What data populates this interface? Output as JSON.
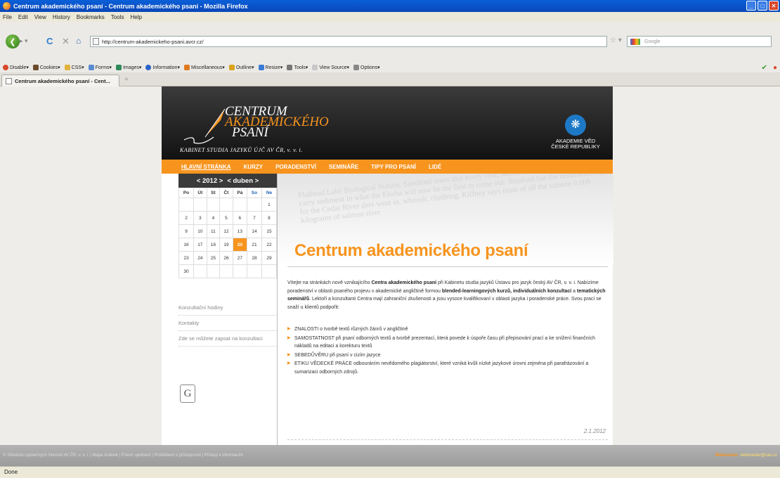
{
  "window": {
    "title": "Centrum akademického psaní - Centrum akademického psaní - Mozilla Firefox"
  },
  "menu": [
    "File",
    "Edit",
    "View",
    "History",
    "Bookmarks",
    "Tools",
    "Help"
  ],
  "nav": {
    "url": "http://centrum-akademickeho-psani.avcr.cz/",
    "search_placeholder": "Google"
  },
  "devtoolbar": [
    "Disable▾",
    "Cookies▾",
    "CSS▾",
    "Forms▾",
    "Images▾",
    "Information▾",
    "Miscellaneous▾",
    "Outline▾",
    "Resize▾",
    "Tools▾",
    "View Source▾",
    "Options▾"
  ],
  "tab": {
    "label": "Centrum akademického psaní - Cent...",
    "new": "+"
  },
  "site": {
    "logo": {
      "line1": "CENTRUM",
      "line2": "AKADEMICKÉHO",
      "line3": "PSANÍ",
      "subtitle": "KABINET STUDIA JAZYKŮ ÚJČ AV ČR, v. v. i."
    },
    "avcr": {
      "line1": "AKADEMIE VĚD",
      "line2": "ČESKÉ REPUBLIKY"
    },
    "menu": [
      "HLAVNÍ STRÁNKA",
      "KURZY",
      "PORADENSTVÍ",
      "SEMINÁŘE",
      "TIPY PRO PSANÍ",
      "LIDÉ"
    ],
    "calendar": {
      "year_nav": "< 2012 >",
      "month_nav": "< duben >",
      "weekdays": [
        "Po",
        "Út",
        "St",
        "Čt",
        "Pá",
        "So",
        "Ne"
      ],
      "weeks": [
        [
          "",
          "",
          "",
          "",
          "",
          "",
          "1"
        ],
        [
          "2",
          "3",
          "4",
          "5",
          "6",
          "7",
          "8"
        ],
        [
          "9",
          "10",
          "11",
          "12",
          "13",
          "14",
          "15"
        ],
        [
          "16",
          "17",
          "18",
          "19",
          "20",
          "21",
          "22"
        ],
        [
          "23",
          "24",
          "25",
          "26",
          "27",
          "28",
          "29"
        ],
        [
          "30",
          "",
          "",
          "",
          "",
          "",
          ""
        ]
      ],
      "today": "20"
    },
    "side_links": [
      "Konzultační hodiny",
      "Kontakty",
      "Zde se můžete zapsat na konzultaci"
    ],
    "hero_text": "Flathead Lake Biological Station. Sandford notes that every year, salmon streams such as Alaska carry sediment in what the Elwha will now be the first to come out. Stanford has the restoration day for the Cedar River ders went in, whoosh, climbing, Kiffney says mass of all the salmon 0.006 kilograms of salmon river",
    "heading": "Centrum akademického psaní",
    "intro": {
      "p1": "Vítejte na stránkách nově vznikajícího ",
      "b1": "Centra akademického psaní",
      "p2": " při Kabinetu studia jazyků Ústavu pro jazyk český AV ČR, v. v. i. Nabízíme poradenství v oblasti psaného projevu v akademické angličtině formou ",
      "b2": "blended-learningových kurzů, individuálních konzultací",
      "p3": " a ",
      "b3": "tematických seminářů",
      "p4": ". Lektoři a konzultanti Centra mají zahraniční zkušenosti a jsou vysoce kvalifikovaní v oblasti jazyka i poradenské práce. Svou prací se snaží u klientů podpořit:"
    },
    "list": [
      "ZNALOSTI o tvorbě textů různých žánrů v angličtině",
      "SAMOSTATNOST při psaní odborných textů a tvorbě prezentací, která povede k úspoře času při přepisování prací a ke snížení finančních nákladů na editaci a korekturu textů",
      "SEBEDŮVĚRU při psaní v cizím jazyce",
      "ETIKU VĚDECKÉ PRÁCE odbouráním nevědomého plagiátorství, které vzniká kvůli nízké jazykové úrovni zejména při parafrázování a sumarizaci odborných zdrojů."
    ],
    "date": "2.1.2012",
    "footer": "© Středisko společných činností AV ČR, v. v. i.  |  Mapa stránek  |  Právní ujednání  |  Prohlášení o přístupnosti  |  Přístup k informacím",
    "webmaster_label": "Webmaster:",
    "webmaster_email": "webmaster@cas.cz"
  },
  "status": "Done"
}
